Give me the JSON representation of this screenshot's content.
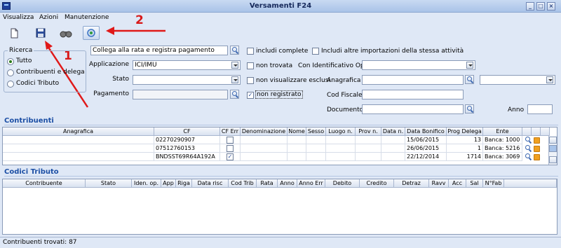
{
  "window": {
    "title": "Versamenti F24"
  },
  "menu": [
    {
      "label": "Visualizza",
      "accel": "V"
    },
    {
      "label": "Azioni",
      "accel": "A"
    },
    {
      "label": "Manutenzione",
      "accel": "M"
    }
  ],
  "toolbar": {
    "buttons": [
      {
        "icon": "new-document-icon"
      },
      {
        "icon": "save-icon"
      },
      {
        "icon": "binoculars-icon"
      },
      {
        "icon": "refresh-gear-icon"
      }
    ]
  },
  "annotations": {
    "label_1": "1",
    "label_2": "2",
    "arrow_color": "#e01919"
  },
  "ricerca": {
    "legend": "Ricerca",
    "options": [
      {
        "label": "Tutto",
        "selected": true
      },
      {
        "label": "Contribuenti e delega",
        "selected": false
      },
      {
        "label": "Codici Tributo",
        "selected": false
      }
    ]
  },
  "filters": {
    "action_combo_value": "Collega alla rata e registra pagamento",
    "applicazione_label": "Applicazione",
    "applicazione_value": "ICI/IMU",
    "stato_label": "Stato",
    "stato_value": "",
    "pagamento_label": "Pagamento",
    "pagamento_value": "",
    "includi_complete": "includi complete",
    "includi_altre": "Includi altre importazioni della stessa attività",
    "non_trovata": "non trovata",
    "con_identificativo": "Con Identificativo Op",
    "non_visualizzare": "non visualizzare esclusi",
    "anagrafica_label": "Anagrafica",
    "non_registrato": "non registrato",
    "cod_fiscale_label": "Cod Fiscale",
    "documento_label": "Documento",
    "anno_label": "Anno"
  },
  "contribuenti": {
    "title": "Contribuenti",
    "columns": [
      "Anagrafica",
      "CF",
      "CF Err",
      "Denominazione",
      "Nome",
      "Sesso",
      "Luogo n.",
      "Prov n.",
      "Data n.",
      "Data Bonifico",
      "Prog Delega",
      "Ente"
    ],
    "rows": [
      {
        "anagrafica": "",
        "cf": "02270290907",
        "cf_err": false,
        "data_bonifico": "15/06/2015",
        "prog_delega": "13",
        "ente": "Banca: 1000"
      },
      {
        "anagrafica": "",
        "cf": "07512760153",
        "cf_err": false,
        "data_bonifico": "26/06/2015",
        "prog_delega": "1",
        "ente": "Banca: 5216"
      },
      {
        "anagrafica": "",
        "cf": "BNDSST69R64A192A",
        "cf_err": true,
        "data_bonifico": "22/12/2014",
        "prog_delega": "1714",
        "ente": "Banca: 3069"
      }
    ]
  },
  "codici_tributo": {
    "title": "Codici Tributo",
    "columns": [
      "Contribuente",
      "Stato",
      "Iden. op.",
      "App",
      "Riga",
      "Data risc",
      "Cod Trib",
      "Rata",
      "Anno",
      "Anno Err",
      "Debito",
      "Credito",
      "Detraz",
      "Ravv",
      "Acc",
      "Sal",
      "N°Fab"
    ]
  },
  "status": {
    "text": "Contribuenti trovati: 87"
  },
  "colors": {
    "background": "#dfe8f6",
    "section_title": "#1c4fa5",
    "title_bar": "#a9c3e8"
  }
}
